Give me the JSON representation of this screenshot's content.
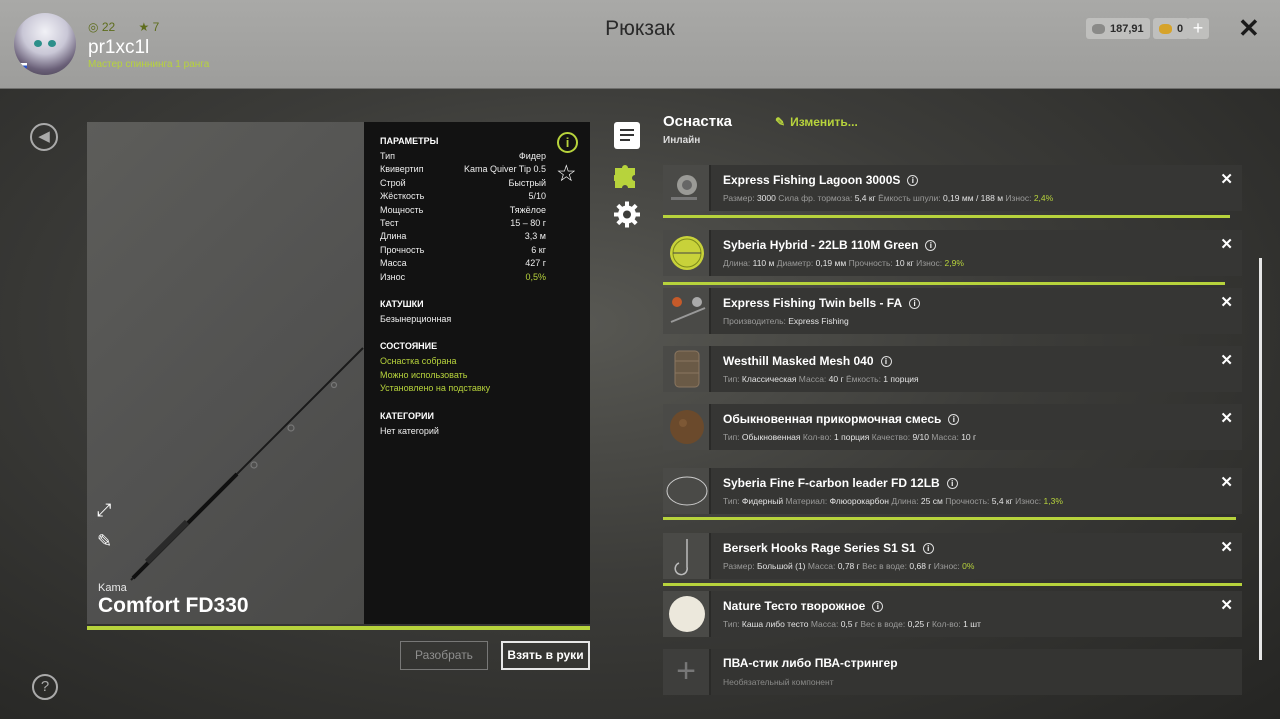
{
  "header": {
    "title": "Рюкзак",
    "username": "pr1xc1l",
    "rank": "Мастер спиннинга 1 ранга",
    "level": "22",
    "stars": "7",
    "currency_silver": "187,91",
    "currency_gold": "0",
    "plus": "+",
    "close": "✕"
  },
  "rod": {
    "brand": "Kama",
    "name": "Comfort FD330",
    "params_title": "ПАРАМЕТРЫ",
    "params": [
      {
        "k": "Тип",
        "v": "Фидер"
      },
      {
        "k": "Квивертип",
        "v": "Kama Quiver Tip 0.5"
      },
      {
        "k": "Строй",
        "v": "Быстрый"
      },
      {
        "k": "Жёсткость",
        "v": "5/10"
      },
      {
        "k": "Мощность",
        "v": "Тяжёлое"
      },
      {
        "k": "Тест",
        "v": "15 – 80 г"
      },
      {
        "k": "Длина",
        "v": "3,3 м"
      },
      {
        "k": "Прочность",
        "v": "6 кг"
      },
      {
        "k": "Масса",
        "v": "427 г"
      },
      {
        "k": "Износ",
        "v": "0,5%"
      }
    ],
    "reels_title": "КАТУШКИ",
    "reels_value": "Безынерционная",
    "state_title": "СОСТОЯНИЕ",
    "state": [
      "Оснастка собрана",
      "Можно использовать",
      "Установлено на подставку"
    ],
    "categories_title": "КАТЕГОРИИ",
    "categories_value": "Нет категорий",
    "btn_disassemble": "Разобрать",
    "btn_take": "Взять в руки"
  },
  "panel": {
    "title": "Оснастка",
    "subtitle": "Инлайн",
    "edit": "Изменить..."
  },
  "items": [
    {
      "name": "Express Fishing Lagoon 3000S",
      "fields": [
        [
          "Размер: ",
          "3000"
        ],
        [
          "Сила фр. тормоза: ",
          "5,4 кг"
        ],
        [
          "Ёмкость шпули: ",
          "0,19 мм / 188 м"
        ],
        [
          "Износ: ",
          "2,4%"
        ]
      ],
      "wear": 0.98
    },
    {
      "name": "Syberia Hybrid - 22LB 110M Green",
      "fields": [
        [
          "Длина: ",
          "110 м"
        ],
        [
          "Диаметр: ",
          "0,19 мм"
        ],
        [
          "Прочность: ",
          "10 кг"
        ],
        [
          "Износ: ",
          "2,9%"
        ]
      ],
      "wear": 0.97
    },
    {
      "name": "Express Fishing Twin bells - FA",
      "fields": [
        [
          "Производитель: ",
          "Express Fishing"
        ]
      ]
    },
    {
      "name": "Westhill Masked Mesh 040",
      "fields": [
        [
          "Тип: ",
          "Классическая"
        ],
        [
          "Масса: ",
          "40 г"
        ],
        [
          "Ёмкость: ",
          "1 порция"
        ]
      ]
    },
    {
      "name": "Обыкновенная прикормочная смесь",
      "fields": [
        [
          "Тип: ",
          "Обыкновенная"
        ],
        [
          "Кол-во: ",
          "1 порция"
        ],
        [
          "Качество: ",
          "9/10"
        ],
        [
          "Масса: ",
          "10 г"
        ]
      ]
    },
    {
      "name": "Syberia Fine F-carbon leader FD 12LB",
      "fields": [
        [
          "Тип: ",
          "Фидерный"
        ],
        [
          "Материал: ",
          "Флюорокарбон"
        ],
        [
          "Длина: ",
          "25 см"
        ],
        [
          "Прочность: ",
          "5,4 кг"
        ],
        [
          "Износ: ",
          "1,3%"
        ]
      ],
      "wear": 0.99
    },
    {
      "name": "Berserk Hooks Rage Series S1 S1",
      "fields": [
        [
          "Размер: ",
          "Большой (1)"
        ],
        [
          "Масса: ",
          "0,78 г"
        ],
        [
          "Вес в воде: ",
          "0,68 г"
        ],
        [
          "Износ: ",
          "0%"
        ]
      ],
      "wear": 1.0
    },
    {
      "name": "Nature Тесто творожное",
      "fields": [
        [
          "Тип: ",
          "Каша либо тесто"
        ],
        [
          "Масса: ",
          "0,5 г"
        ],
        [
          "Вес в воде: ",
          "0,25 г"
        ],
        [
          "Кол-во: ",
          "1 шт"
        ]
      ]
    }
  ],
  "optional_item": {
    "name": "ПВА-стик либо ПВА-стрингер",
    "desc": "Необязательный компонент"
  },
  "colors": {
    "accent": "#b7d33c",
    "panel_bg": "#121212",
    "item_bg": "#363634"
  }
}
